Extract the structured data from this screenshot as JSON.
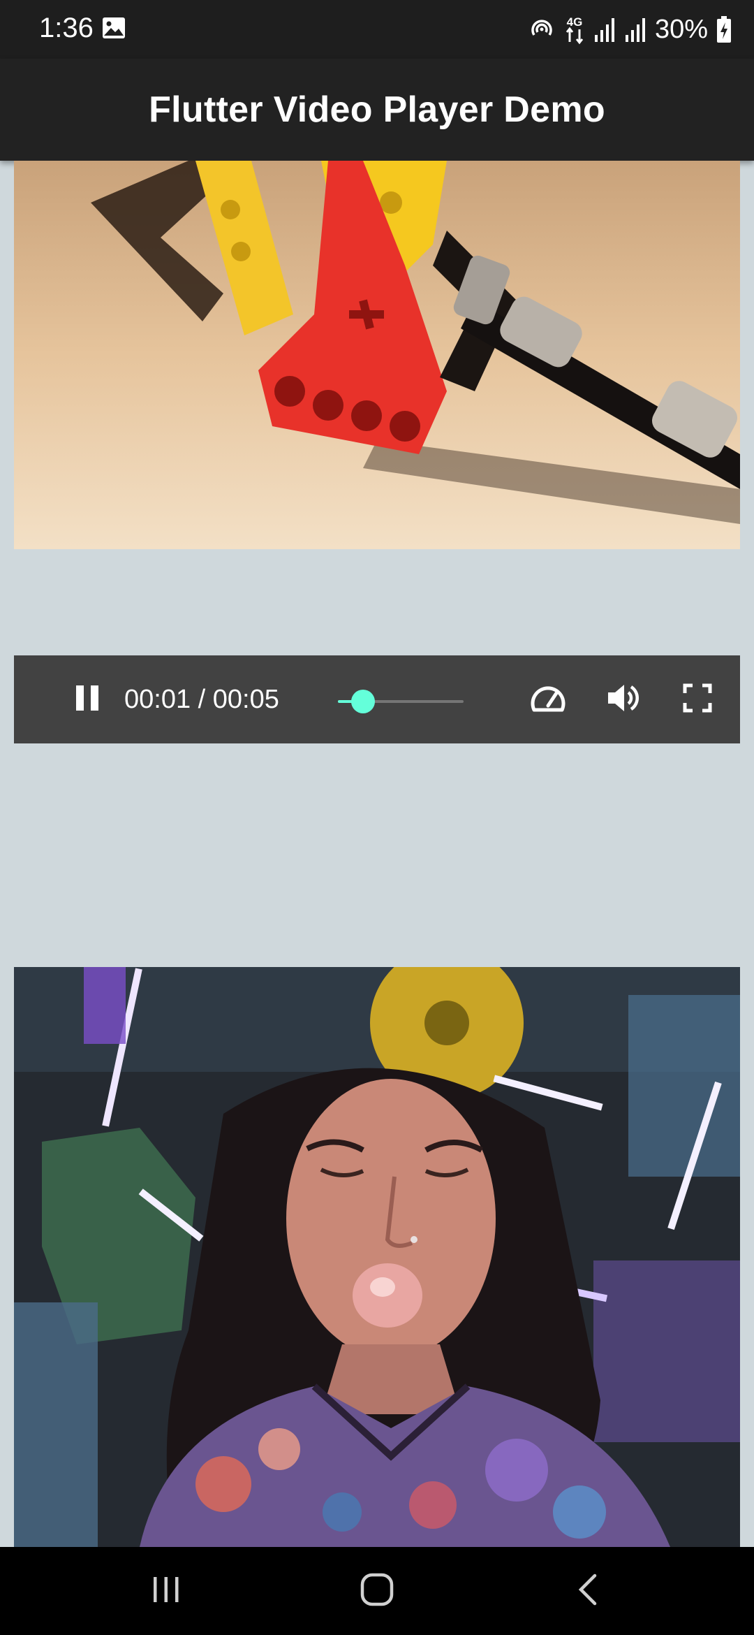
{
  "status_bar": {
    "time": "1:36",
    "network": "4G",
    "battery": "30%",
    "icons": [
      "gallery-icon",
      "hotspot-icon",
      "network-4g-icon",
      "signal-icon",
      "signal-icon",
      "battery-charging-icon"
    ]
  },
  "app_bar": {
    "title": "Flutter Video Player Demo"
  },
  "video_player": {
    "time_display": "00:01 / 00:05",
    "progress": 0.2,
    "accent": "#64ffda",
    "icons": [
      "pause-icon",
      "playback-speed-icon",
      "volume-icon",
      "fullscreen-icon"
    ]
  },
  "nav_bar": {
    "icons": [
      "recents-icon",
      "home-icon",
      "back-icon"
    ]
  }
}
